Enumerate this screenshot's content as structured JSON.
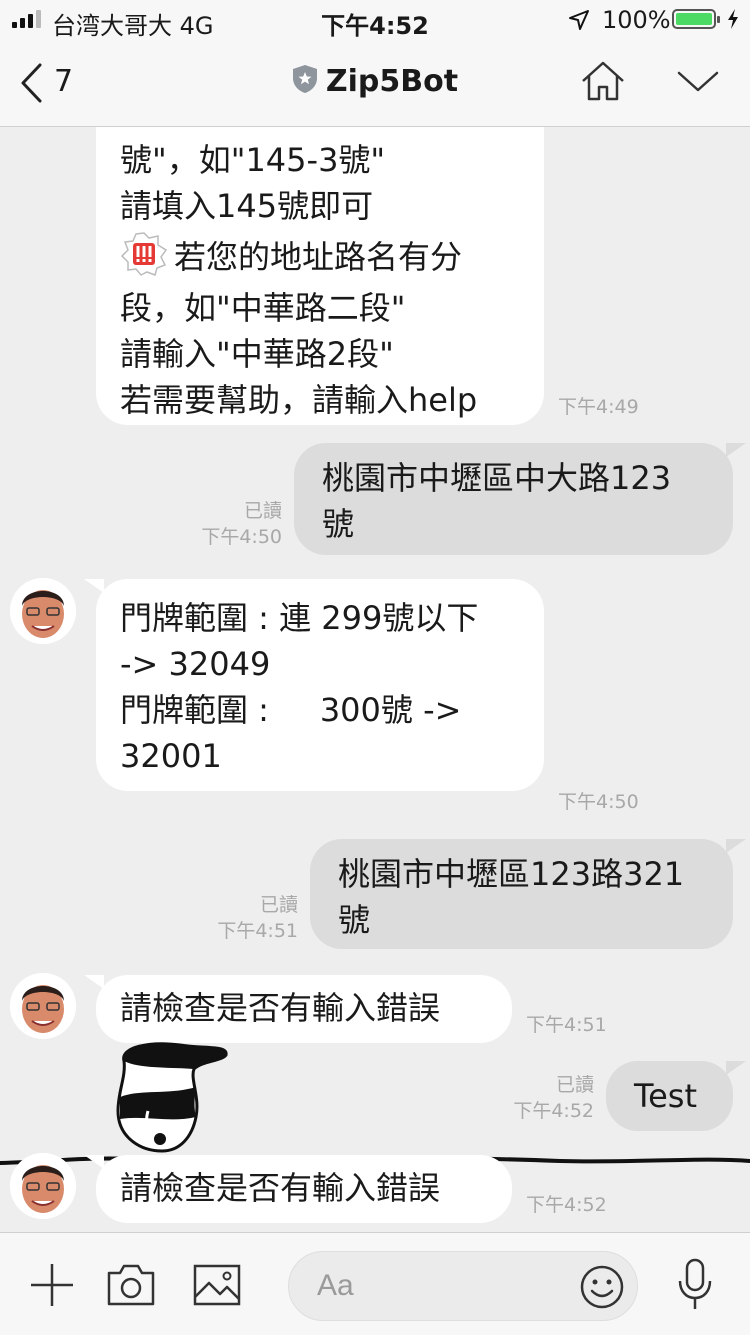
{
  "status_bar": {
    "carrier": "台湾大哥大   4G",
    "time": "下午4:52",
    "battery": "100%"
  },
  "header": {
    "back_count": "7",
    "title": "Zip5Bot"
  },
  "messages": {
    "m1": {
      "lines": [
        "號\"，如\"145-3號\"",
        "請填入145號即可",
        "若您的地址路名有分",
        "段，如\"中華路二段\"",
        "請輸入\"中華路2段\"",
        "若需要幫助，請輸入help"
      ],
      "time": "下午4:49"
    },
    "m2": {
      "lines": [
        "桃園市中壢區中大路123",
        "號"
      ],
      "read": "已讀",
      "time": "下午4:50"
    },
    "m3": {
      "lines": [
        "門牌範圍 : 連 299號以下",
        "-> 32049",
        "門牌範圍 :     300號 ->",
        "32001"
      ],
      "time": "下午4:50"
    },
    "m4": {
      "lines": [
        "桃園市中壢區123路321",
        "號"
      ],
      "read": "已讀",
      "time": "下午4:51"
    },
    "m5": {
      "lines": [
        "請檢查是否有輸入錯誤"
      ],
      "time": "下午4:51"
    },
    "m6": {
      "lines": [
        "Test"
      ],
      "read": "已讀",
      "time": "下午4:52"
    },
    "m7": {
      "lines": [
        "請檢查是否有輸入錯誤"
      ],
      "time": "下午4:52"
    }
  },
  "input": {
    "placeholder": "Aa"
  },
  "icons": [
    "back-chevron-icon",
    "shield-icon",
    "home-icon",
    "chevron-down-icon",
    "plus-icon",
    "camera-icon",
    "image-icon",
    "emoji-icon",
    "microphone-icon",
    "warning-emoji-icon"
  ],
  "colors": {
    "incoming_bubble": "#ffffff",
    "outgoing_bubble": "#dcdcdc",
    "chat_background": "#eeeeee",
    "battery": "#4cd964"
  }
}
